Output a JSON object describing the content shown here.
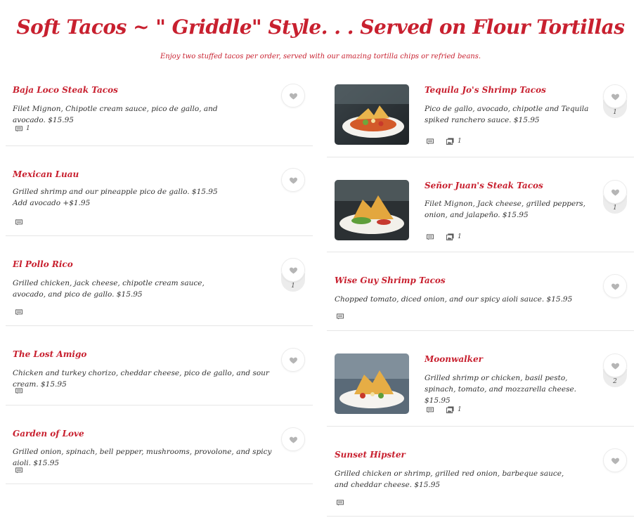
{
  "page": {
    "title": "Soft Tacos ~ \" Griddle\" Style. . . Served on Flour Tortillas",
    "subtitle": "Enjoy two stuffed tacos per order, served with our amazing tortilla chips or refried beans."
  },
  "left_items": [
    {
      "name": "Baja Loco Steak Tacos",
      "description": "Filet Mignon, Chipotle cream sauce, pico de gallo, and avocado. $15.95",
      "comments": "1",
      "likes": ""
    },
    {
      "name": "Mexican Luau",
      "description": "Grilled shrimp and our pineapple pico de gallo. $15.95",
      "description2": "Add avocado +$1.95",
      "comments": "",
      "likes": ""
    },
    {
      "name": "El Pollo Rico",
      "description": "Grilled chicken, jack cheese, chipotle cream sauce, avocado, and pico de gallo. $15.95",
      "comments": "",
      "likes": "1"
    },
    {
      "name": "The Lost Amigo",
      "description": "Chicken and turkey chorizo, cheddar cheese, pico de gallo, and sour cream. $15.95",
      "comments": "",
      "likes": ""
    },
    {
      "name": "Garden of Love",
      "description": "Grilled onion, spinach, bell pepper, mushrooms, provolone, and spicy aioli. $15.95",
      "comments": "",
      "likes": ""
    }
  ],
  "right_items": [
    {
      "name": "Tequila Jo's Shrimp Tacos",
      "description": "Pico de gallo, avocado, chipotle and Tequila spiked ranchero sauce. $15.95",
      "photos": "1",
      "likes": "1"
    },
    {
      "name": "Señor Juan's Steak Tacos",
      "description": "Filet Mignon, Jack cheese, grilled peppers, onion, and jalapeño. $15.95",
      "photos": "1",
      "likes": "1"
    },
    {
      "name": "Wise Guy Shrimp Tacos",
      "description": "Chopped tomato, diced onion, and our spicy aioli sauce. $15.95",
      "photos": "",
      "likes": ""
    },
    {
      "name": "Moonwalker",
      "description": "Grilled shrimp or chicken, basil pesto, spinach, tomato, and mozzarella cheese. $15.95",
      "photos": "1",
      "likes": "2"
    },
    {
      "name": "Sunset Hipster",
      "description": "Grilled chicken or shrimp, grilled red onion, barbeque sauce, and cheddar cheese. $15.95",
      "photos": "",
      "likes": ""
    }
  ],
  "icons": {
    "comment": "comment-icon",
    "photo": "photo-icon",
    "heart": "heart-icon"
  },
  "colors": {
    "accent": "#c8202f",
    "text": "#333333",
    "divider": "#e6e6e6",
    "heart": "#b5b5b5"
  }
}
